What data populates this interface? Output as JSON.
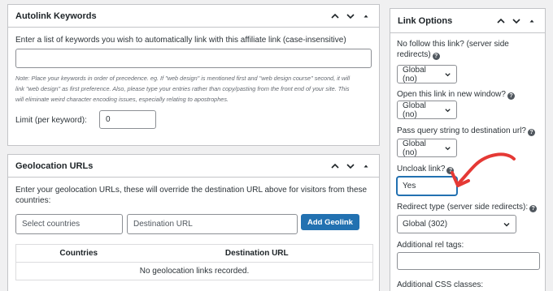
{
  "autolink": {
    "title": "Autolink Keywords",
    "description": "Enter a list of keywords you wish to automatically link with this affiliate link (case-insensitive)",
    "keywords_value": "",
    "note_lines": [
      "Note: Place your keywords in order of precedence. eg. If \"web design\" is mentioned first and \"web design course\" second, it will",
      "link \"web design\" as first preference. Also, please type your entries rather than copy/pasting from the front end of your site. This",
      "will eliminate weird character encoding issues, especially relating to apostrophes."
    ],
    "limit_label": "Limit (per keyword):",
    "limit_value": "0"
  },
  "geolocation": {
    "title": "Geolocation URLs",
    "description_lines": [
      "Enter your geolocation URLs, these will override the destination URL above for visitors from these",
      "countries:"
    ],
    "countries_placeholder": "Select countries",
    "destination_placeholder": "Destination URL",
    "add_button": "Add Geolink",
    "columns": [
      "Countries",
      "Destination URL"
    ],
    "empty_message": "No geolocation links recorded."
  },
  "link_options": {
    "title": "Link Options",
    "nofollow_label_lines": [
      "No follow this link? (server side",
      "redirects)"
    ],
    "nofollow_value": "Global (no)",
    "new_window_label": "Open this link in new window?",
    "new_window_value": "Global (no)",
    "query_string_label": "Pass query string to destination url?",
    "query_string_value": "Global (no)",
    "uncloak_label": "Uncloak link?",
    "uncloak_value": "Yes",
    "redirect_type_label": "Redirect type (server side redirects):",
    "redirect_type_value": "Global (302)",
    "rel_tags_label": "Additional rel tags:",
    "rel_tags_value": "",
    "css_classes_label": "Additional CSS classes:"
  },
  "colors": {
    "primary": "#2271b1",
    "annotation_arrow": "#e53935",
    "border": "#c3c4c7",
    "background": "#f0f0f1"
  },
  "icons": [
    "chevron-up-icon",
    "chevron-down-icon",
    "triangle-toggle-icon",
    "help-icon",
    "select-arrow-icon",
    "annotation-arrow-icon"
  ]
}
